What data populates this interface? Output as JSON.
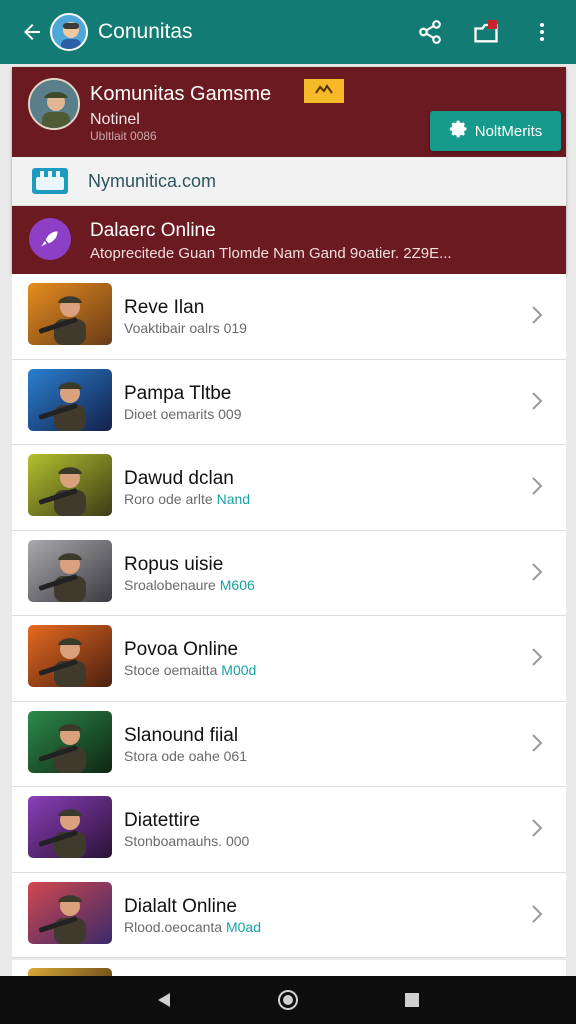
{
  "appbar": {
    "title": "Conunitas",
    "back_icon": "arrow-back-icon",
    "actions": [
      "share-icon",
      "notification-badge-icon",
      "more-vert-icon"
    ],
    "color": "#127b73"
  },
  "community": {
    "title": "Komunitas Gamsme",
    "subtitle": "Notinel",
    "meta": "Ubltlait 0086",
    "notify_label": "NoltMerits",
    "website": "Nymunitica.com",
    "online_title": "Dalaerc Online",
    "online_desc": "Atoprecitede Guan Tlomde Nam Gand 9oatier. 2Z9E..."
  },
  "list": [
    {
      "title": "Reve Ilan",
      "sub_prefix": "Voaktibair oalrs 019",
      "sub_accent": "",
      "thumb": [
        "#e58d1e",
        "#6a3b18"
      ]
    },
    {
      "title": "Pampa Tltbe",
      "sub_prefix": "Dioet oemarits 009",
      "sub_accent": "",
      "thumb": [
        "#2a7fcf",
        "#14214a"
      ]
    },
    {
      "title": "Dawud dclan",
      "sub_prefix": "Roro ode arlte ",
      "sub_accent": "Nand",
      "thumb": [
        "#b2c12d",
        "#3b3b17"
      ]
    },
    {
      "title": "Ropus uisie",
      "sub_prefix": "Sroalobenaure ",
      "sub_accent": "M606",
      "thumb": [
        "#a9a9ad",
        "#3a3a40"
      ]
    },
    {
      "title": "Povoa Online",
      "sub_prefix": "Stoce oemaitta ",
      "sub_accent": "M00d",
      "thumb": [
        "#e66a1f",
        "#4a1f10"
      ]
    },
    {
      "title": "Slanound fiial",
      "sub_prefix": "Stora ode oahe 061",
      "sub_accent": "",
      "thumb": [
        "#2c8a4a",
        "#0f2614"
      ]
    },
    {
      "title": "Diatettire",
      "sub_prefix": "Stonboamauhs. 000",
      "sub_accent": "",
      "thumb": [
        "#8a3fb8",
        "#2a1236"
      ]
    },
    {
      "title": "Dialalt Online",
      "sub_prefix": "Rlood.oeocanta ",
      "sub_accent": "M0ad",
      "thumb": [
        "#d1474f",
        "#3a2a6a"
      ]
    }
  ],
  "navbar": {
    "icons": [
      "back-triangle-icon",
      "home-circle-icon",
      "recents-square-icon"
    ]
  }
}
